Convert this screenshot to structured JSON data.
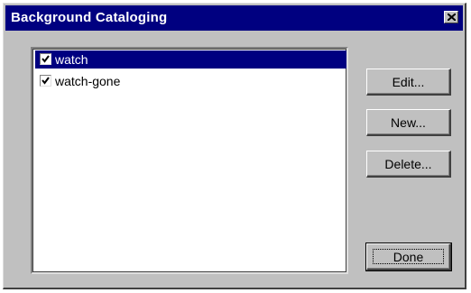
{
  "window": {
    "title": "Background Cataloging",
    "close_icon": "close-icon"
  },
  "list": {
    "items": [
      {
        "label": "watch",
        "checked": true,
        "selected": true
      },
      {
        "label": "watch-gone",
        "checked": true,
        "selected": false
      }
    ]
  },
  "buttons": {
    "edit_label": "Edit...",
    "new_label": "New...",
    "delete_label": "Delete...",
    "done_label": "Done"
  },
  "colors": {
    "title_bar": "#000080",
    "selection": "#000080",
    "face": "#c0c0c0"
  }
}
